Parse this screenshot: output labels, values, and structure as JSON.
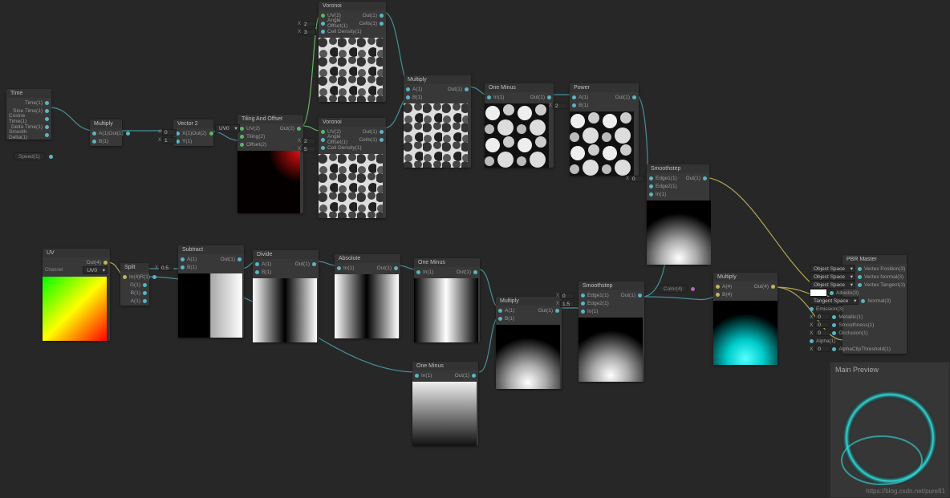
{
  "watermark": "https://blog.csdn.net/pure81",
  "main_preview_label": "Main Preview",
  "nodes": {
    "time": {
      "title": "Time",
      "outputs": [
        "Time(1)",
        "Sine Time(1)",
        "Cosine Time(1)",
        "Delta Time(1)",
        "Smooth Delta(1)"
      ],
      "speed_label": "Speed(1)"
    },
    "multiply1": {
      "title": "Multiply",
      "a": "A(1)",
      "b": "B(1)",
      "out": "Out(1)"
    },
    "vector2": {
      "title": "Vector 2",
      "x": "X(1)",
      "y": "Y(1)",
      "out": "Out(2)",
      "vx": "0",
      "vy": "1"
    },
    "tiling": {
      "title": "Tiling And Offset",
      "uv": "UV(2)",
      "tiling_port": "Tiling(2)",
      "offset_port": "Offset(2)",
      "out": "Out(2)",
      "uv_drop": "UV0"
    },
    "voronoi1": {
      "title": "Voronoi",
      "uv": "UV(2)",
      "angle": "Angle Offset(1)",
      "cell": "Cell Density(1)",
      "out": "Out(1)",
      "cells": "Cells(1)",
      "angle_v": "2",
      "cell_v": "3"
    },
    "voronoi2": {
      "title": "Voronoi",
      "uv": "UV(2)",
      "angle": "Angle Offset(1)",
      "cell": "Cell Density(1)",
      "out": "Out(1)",
      "cells": "Cells(1)",
      "angle_v": "2",
      "cell_v": "5"
    },
    "multiply2": {
      "title": "Multiply",
      "a": "A(1)",
      "b": "B(1)",
      "out": "Out(1)"
    },
    "one_minus1": {
      "title": "One Minus",
      "in": "In(1)",
      "out": "Out(1)"
    },
    "power": {
      "title": "Power",
      "a": "A(1)",
      "b": "B(1)",
      "out": "Out(1)",
      "b_v": "2"
    },
    "smoothstep1": {
      "title": "Smoothstep",
      "e1": "Edge1(1)",
      "e2": "Edge2(1)",
      "in": "In(1)",
      "out": "Out(1)",
      "e1_v": "0"
    },
    "uv": {
      "title": "UV",
      "channel_label": "Channel",
      "channel_v": "UV0",
      "out": "Out(4)"
    },
    "split": {
      "title": "Split",
      "in": "In(4)",
      "r": "R(1)",
      "g": "G(1)",
      "b": "B(1)",
      "a": "A(1)",
      "in_v": "0.5"
    },
    "subtract": {
      "title": "Subtract",
      "a": "A(1)",
      "b": "B(1)",
      "out": "Out(1)",
      "b_v": "0.5"
    },
    "divide": {
      "title": "Divide",
      "a": "A(1)",
      "b": "B(1)",
      "out": "Out(1)"
    },
    "absolute": {
      "title": "Absolute",
      "in": "In(1)",
      "out": "Out(1)"
    },
    "one_minus2": {
      "title": "One Minus",
      "in": "In(1)",
      "out": "Out(1)"
    },
    "one_minus3": {
      "title": "One Minus",
      "in": "In(1)",
      "out": "Out(1)"
    },
    "multiply3": {
      "title": "Multiply",
      "a": "A(1)",
      "b": "B(1)",
      "out": "Out(1)"
    },
    "smoothstep2": {
      "title": "Smoothstep",
      "e1": "Edge1(1)",
      "e2": "Edge2(1)",
      "in": "In(1)",
      "out": "Out(1)",
      "e1_v": "0",
      "e2_v": "1.5"
    },
    "multiply4": {
      "title": "Multiply",
      "a": "A(4)",
      "b": "B(4)",
      "out": "Out(4)",
      "color_label": "Color(4)"
    },
    "pbr": {
      "title": "PBR Master",
      "ports": [
        {
          "name": "Vertex Position(3)",
          "left": "Object Space"
        },
        {
          "name": "Vertex Normal(3)",
          "left": "Object Space"
        },
        {
          "name": "Vertex Tangent(3)",
          "left": "Object Space"
        },
        {
          "name": "Albedo(3)",
          "left": "swatch"
        },
        {
          "name": "Normal(3)",
          "left": "Tangent Space"
        },
        {
          "name": "Emission(3)",
          "left": ""
        },
        {
          "name": "Metallic(1)",
          "left": "0",
          "prefix": "X"
        },
        {
          "name": "Smoothness(1)",
          "left": "0",
          "prefix": "X"
        },
        {
          "name": "Occlusion(1)",
          "left": "0",
          "prefix": "X"
        },
        {
          "name": "Alpha(1)",
          "left": ""
        },
        {
          "name": "AlphaClipThreshold(1)",
          "left": "0",
          "prefix": "X"
        }
      ]
    }
  }
}
